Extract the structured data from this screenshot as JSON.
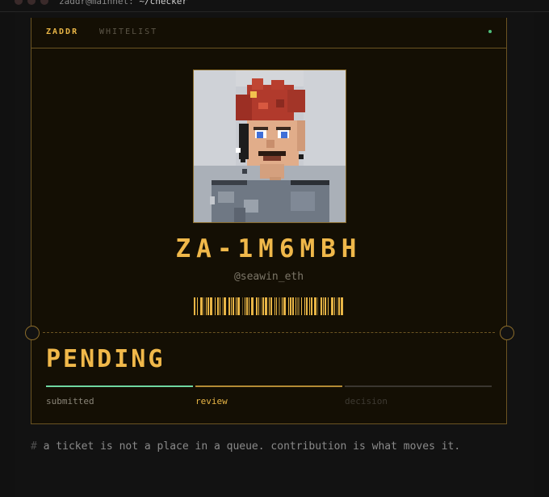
{
  "terminal": {
    "title_user": "zaddr@mainnet:",
    "title_path": " ~/checker"
  },
  "header": {
    "brand": "ZADDR",
    "section": "WHITELIST"
  },
  "ticket": {
    "id": "ZA-1M6MBH",
    "handle": "@seawin_eth",
    "status": "PENDING",
    "steps": [
      {
        "label": "submitted",
        "state": "done",
        "color": "#6fd6a0"
      },
      {
        "label": "review",
        "state": "active",
        "color": "#e8b546"
      },
      {
        "label": "decision",
        "state": "todo",
        "color": "#3a3630"
      }
    ]
  },
  "footer": {
    "hash": "#",
    "quote": " a ticket is not a place in a queue. contribution is what moves it."
  },
  "colors": {
    "accent": "#f0b84a",
    "border": "#6b5422",
    "success": "#6fd6a0"
  }
}
